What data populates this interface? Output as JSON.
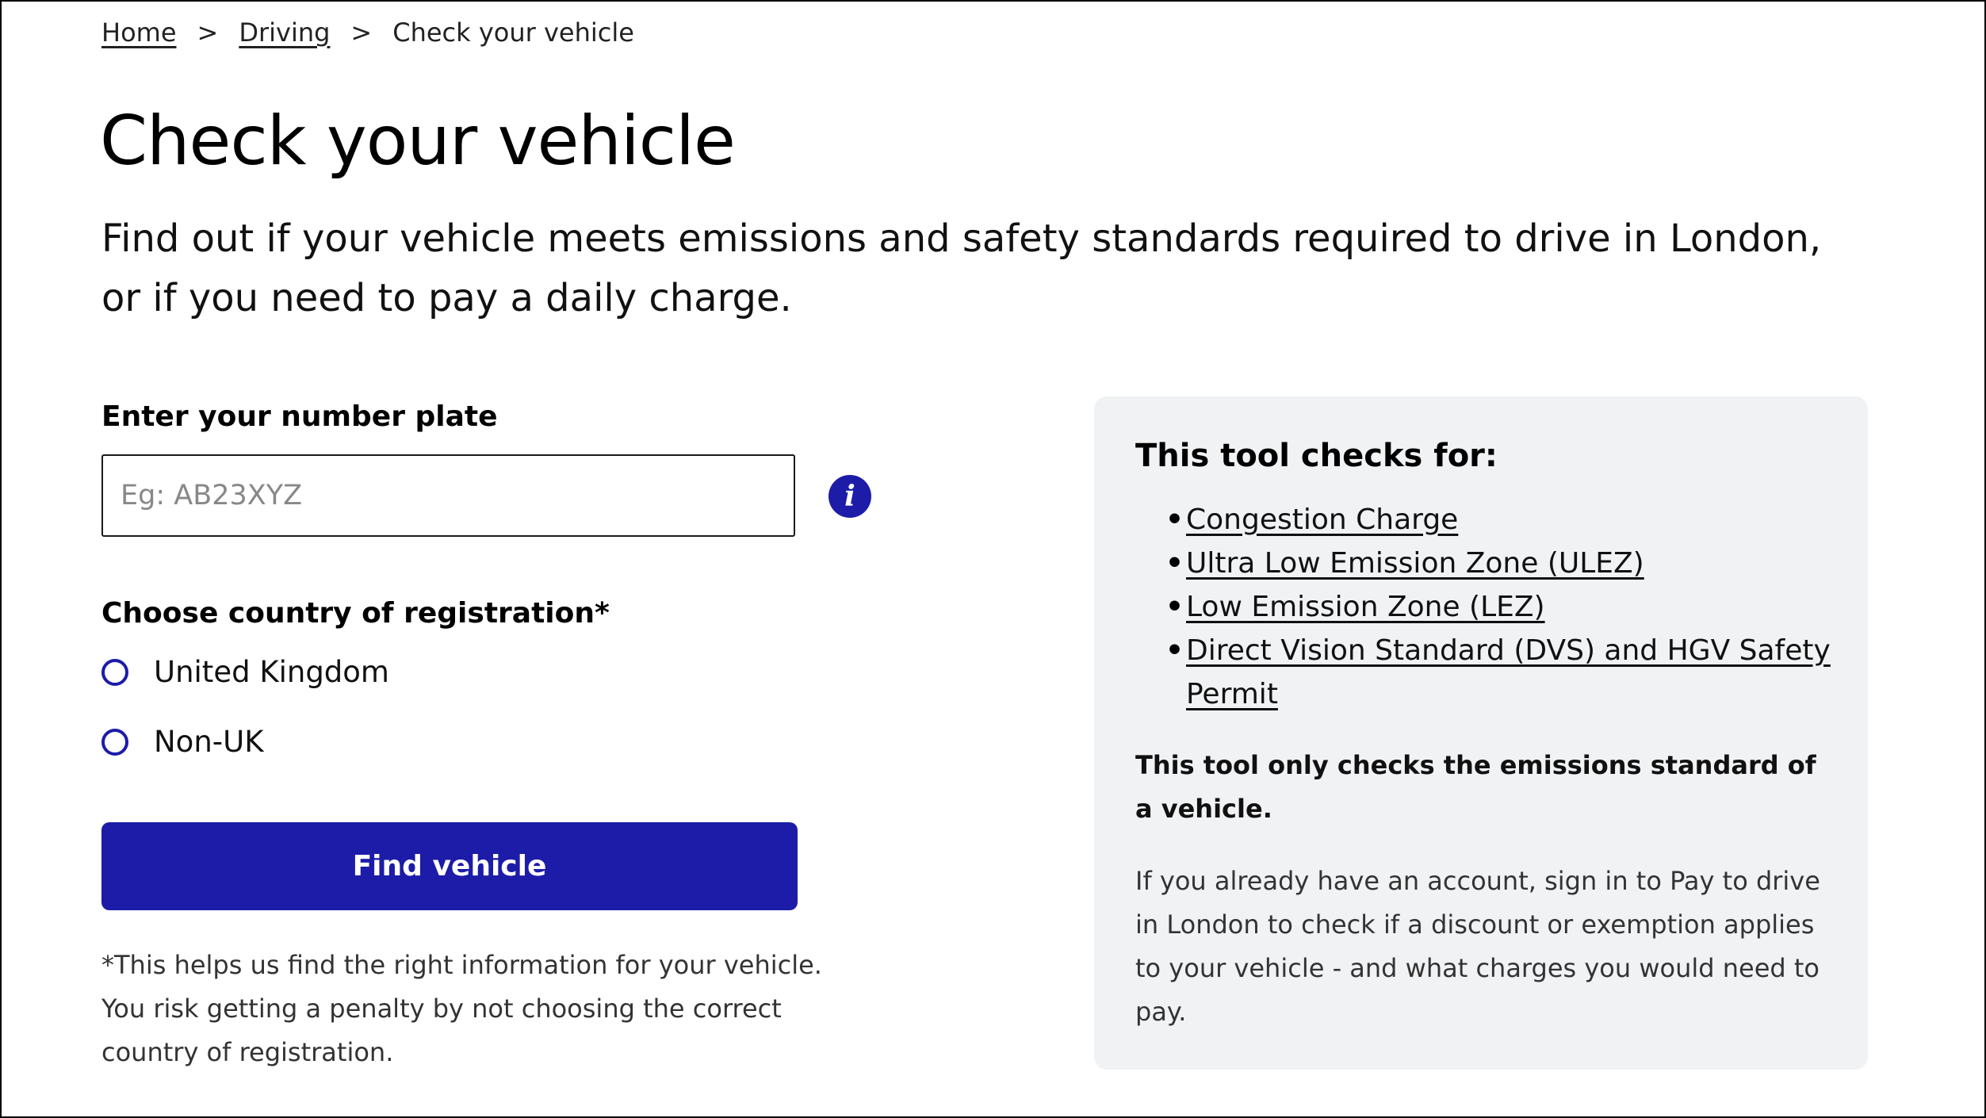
{
  "breadcrumb": {
    "home": "Home",
    "separator1": ">",
    "driving": "Driving",
    "separator2": ">",
    "current": "Check your vehicle"
  },
  "page": {
    "title": "Check your vehicle",
    "intro": "Find out if your vehicle meets emissions and safety standards required to drive in London, or if you need to pay a daily charge."
  },
  "form": {
    "plate_label": "Enter your number plate",
    "plate_placeholder": "Eg: AB23XYZ",
    "plate_value": "",
    "info_icon": "i",
    "country_label": "Choose country of registration*",
    "country_options": [
      {
        "label": "United Kingdom",
        "selected": false
      },
      {
        "label": "Non-UK",
        "selected": false
      }
    ],
    "submit_label": "Find vehicle",
    "footnote": "*This helps us find the right information for your vehicle. You risk getting a penalty by not choosing the correct country of registration."
  },
  "panel": {
    "heading": "This tool checks for:",
    "bullet": "•",
    "links": [
      "Congestion Charge",
      "Ultra Low Emission Zone (ULEZ)",
      "Low Emission Zone (LEZ)",
      "Direct Vision Standard (DVS) and HGV Safety Permit"
    ],
    "note_bold": "This tool only checks the emissions standard of a vehicle.",
    "note": "If you already have an account, sign in to Pay to drive in London to check if a discount or exemption applies to your vehicle - and what charges you would need to pay."
  },
  "colors": {
    "primary": "#1c1ca8",
    "panel_bg": "#f1f2f4",
    "text": "#111111"
  }
}
